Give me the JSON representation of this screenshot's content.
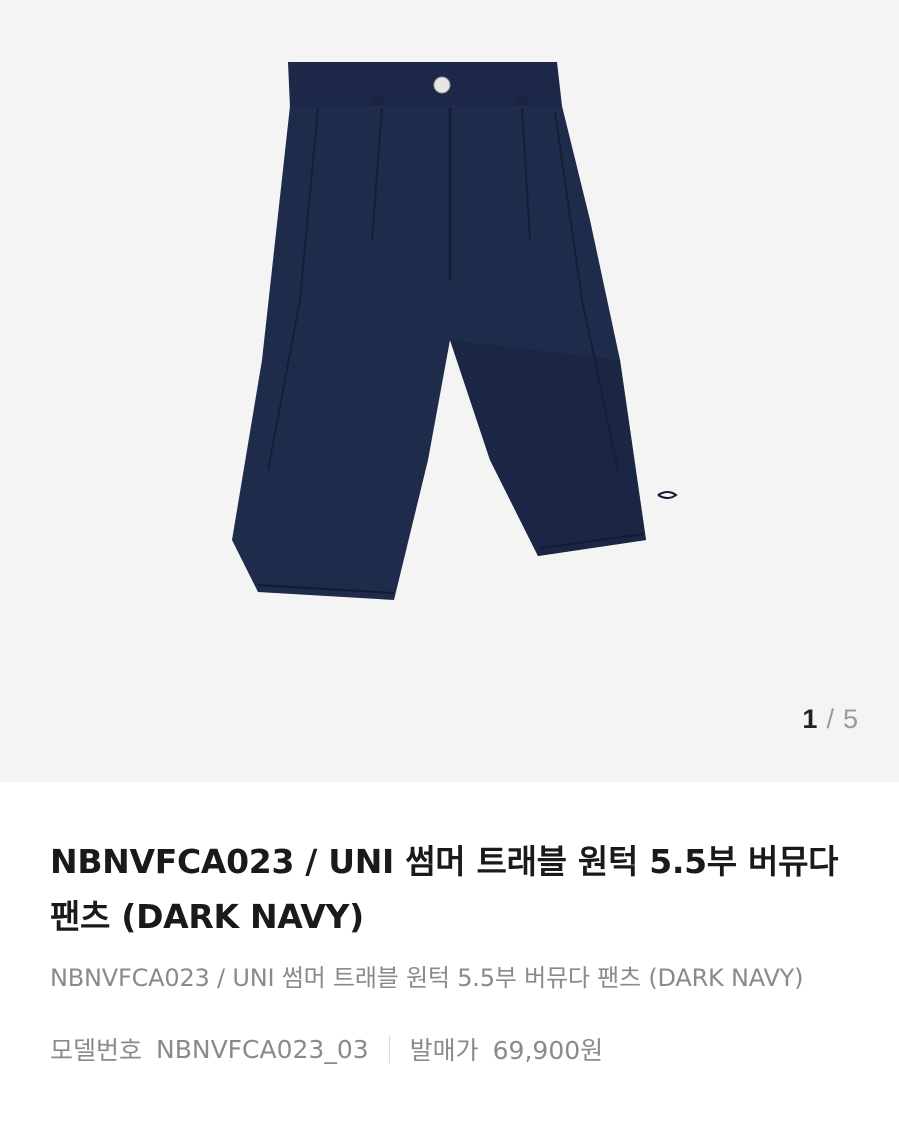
{
  "gallery": {
    "image_alt": "dark navy bermuda shorts",
    "current_page": "1",
    "separator": "/",
    "total_pages": "5"
  },
  "product": {
    "title": "NBNVFCA023 / UNI 썸머 트래블 원턱 5.5부 버뮤다 팬츠 (DARK NAVY)",
    "subtitle": "NBNVFCA023 / UNI 썸머 트래블 원턱 5.5부 버뮤다 팬츠 (DARK NAVY)",
    "model_label": "모델번호",
    "model_value": "NBNVFCA023_03",
    "price_label": "발매가",
    "price_value": "69,900원"
  },
  "colors": {
    "gallery_bg": "#f4f4f4",
    "shorts_navy": "#1e2a4a",
    "title": "#1a1a1a",
    "muted": "#8a8a8a"
  }
}
